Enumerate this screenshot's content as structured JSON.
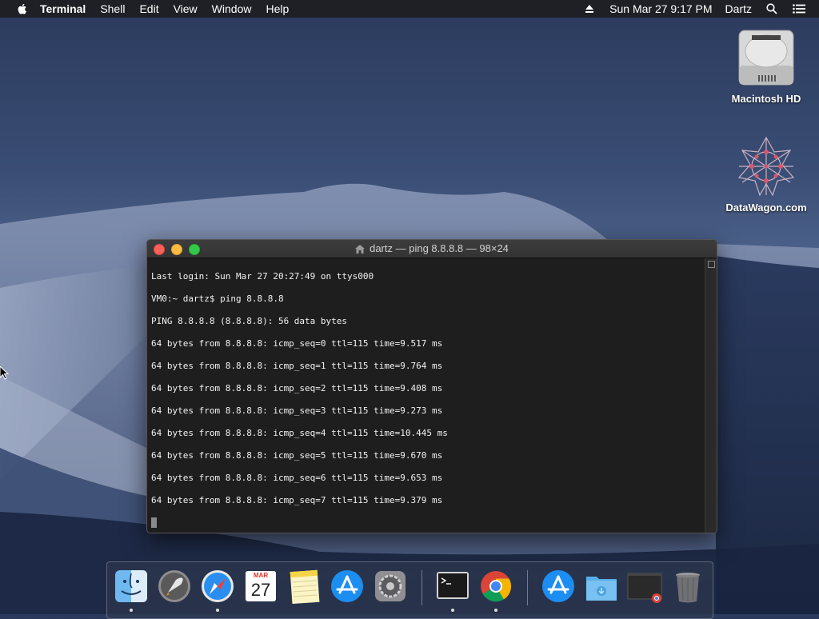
{
  "menubar": {
    "app_name": "Terminal",
    "items": [
      "Shell",
      "Edit",
      "View",
      "Window",
      "Help"
    ],
    "clock": "Sun Mar 27  9:17 PM",
    "user": "Dartz"
  },
  "desktop": {
    "icons": [
      {
        "label": "Macintosh HD"
      },
      {
        "label": "DataWagon.com"
      }
    ]
  },
  "terminal": {
    "title": "dartz — ping 8.8.8.8 — 98×24",
    "lines": [
      "Last login: Sun Mar 27 20:27:49 on ttys000",
      "VM0:~ dartz$ ping 8.8.8.8",
      "PING 8.8.8.8 (8.8.8.8): 56 data bytes",
      "64 bytes from 8.8.8.8: icmp_seq=0 ttl=115 time=9.517 ms",
      "64 bytes from 8.8.8.8: icmp_seq=1 ttl=115 time=9.764 ms",
      "64 bytes from 8.8.8.8: icmp_seq=2 ttl=115 time=9.408 ms",
      "64 bytes from 8.8.8.8: icmp_seq=3 ttl=115 time=9.273 ms",
      "64 bytes from 8.8.8.8: icmp_seq=4 ttl=115 time=10.445 ms",
      "64 bytes from 8.8.8.8: icmp_seq=5 ttl=115 time=9.670 ms",
      "64 bytes from 8.8.8.8: icmp_seq=6 ttl=115 time=9.653 ms",
      "64 bytes from 8.8.8.8: icmp_seq=7 ttl=115 time=9.379 ms"
    ]
  },
  "dock": {
    "items": [
      {
        "icon": "finder-icon",
        "running": true
      },
      {
        "icon": "launchpad-icon",
        "running": false
      },
      {
        "icon": "safari-icon",
        "running": true
      },
      {
        "icon": "calendar-icon",
        "running": false,
        "month": "MAR",
        "day": "27"
      },
      {
        "icon": "notes-icon",
        "running": false
      },
      {
        "icon": "app-store-icon",
        "running": false
      },
      {
        "icon": "system-preferences-icon",
        "running": false
      },
      {
        "icon": "terminal-icon",
        "running": true
      },
      {
        "icon": "chrome-icon",
        "running": true
      },
      {
        "icon": "app-store-folder-icon",
        "running": false
      },
      {
        "icon": "downloads-folder-icon",
        "running": false
      },
      {
        "icon": "minimized-window-icon",
        "running": false
      },
      {
        "icon": "trash-icon",
        "running": false
      }
    ]
  }
}
